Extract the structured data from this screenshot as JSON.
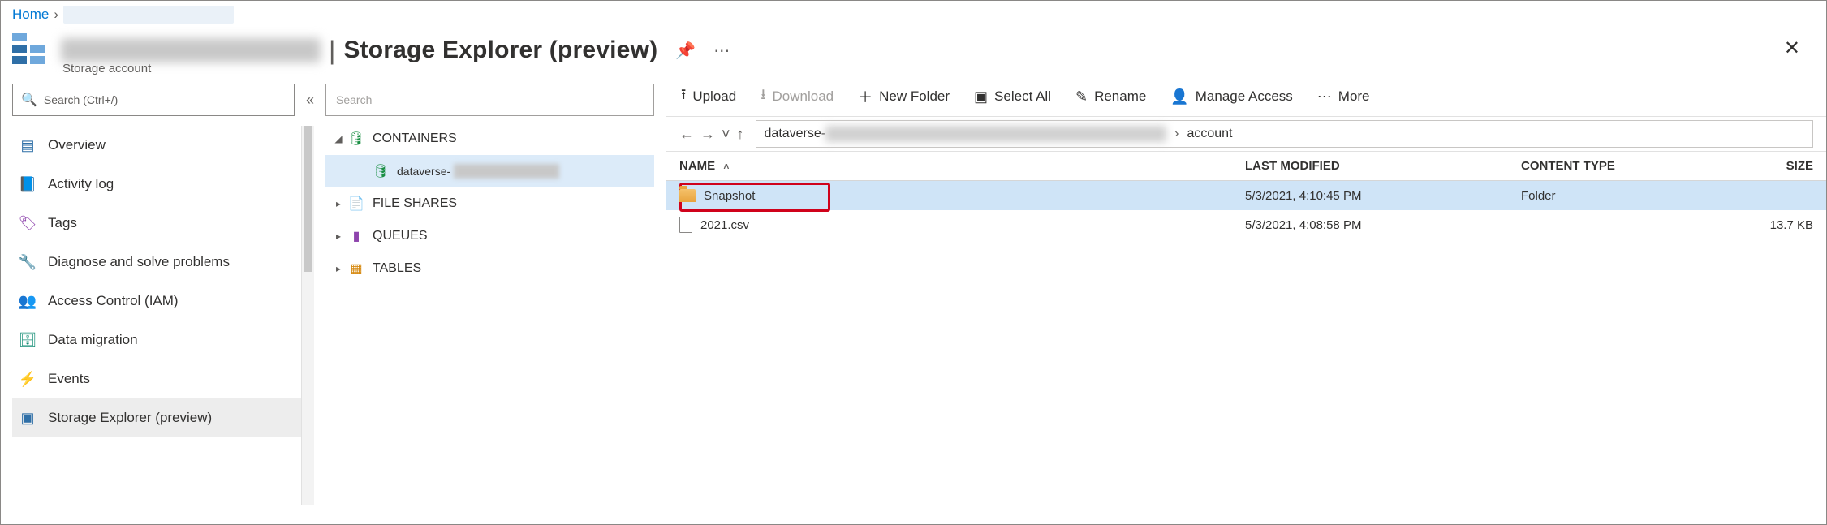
{
  "breadcrumb": {
    "home": "Home"
  },
  "header": {
    "title": "Storage Explorer (preview)",
    "subtype": "Storage account"
  },
  "leftNav": {
    "search_placeholder": "Search (Ctrl+/)",
    "items": [
      {
        "label": "Overview",
        "icon": "overview"
      },
      {
        "label": "Activity log",
        "icon": "activity"
      },
      {
        "label": "Tags",
        "icon": "tags"
      },
      {
        "label": "Diagnose and solve problems",
        "icon": "diagnose"
      },
      {
        "label": "Access Control (IAM)",
        "icon": "iam"
      },
      {
        "label": "Data migration",
        "icon": "migrate"
      },
      {
        "label": "Events",
        "icon": "events"
      },
      {
        "label": "Storage Explorer (preview)",
        "icon": "se",
        "selected": true
      }
    ]
  },
  "tree": {
    "search_placeholder": "Search",
    "containers": "CONTAINERS",
    "container_child": "dataverse-",
    "fileshares": "FILE SHARES",
    "queues": "QUEUES",
    "tables": "TABLES"
  },
  "toolbar": {
    "upload": "Upload",
    "download": "Download",
    "newfolder": "New Folder",
    "selectall": "Select All",
    "rename": "Rename",
    "manageaccess": "Manage Access",
    "more": "More"
  },
  "pathbar": {
    "crumb1": "dataverse-",
    "crumb2": "account"
  },
  "table": {
    "cols": {
      "name": "NAME",
      "modified": "LAST MODIFIED",
      "ctype": "CONTENT TYPE",
      "size": "SIZE"
    },
    "rows": [
      {
        "name": "Snapshot",
        "modified": "5/3/2021, 4:10:45 PM",
        "ctype": "Folder",
        "size": "",
        "kind": "folder",
        "selected": true
      },
      {
        "name": "2021.csv",
        "modified": "5/3/2021, 4:08:58 PM",
        "ctype": "",
        "size": "13.7 KB",
        "kind": "file"
      }
    ]
  }
}
